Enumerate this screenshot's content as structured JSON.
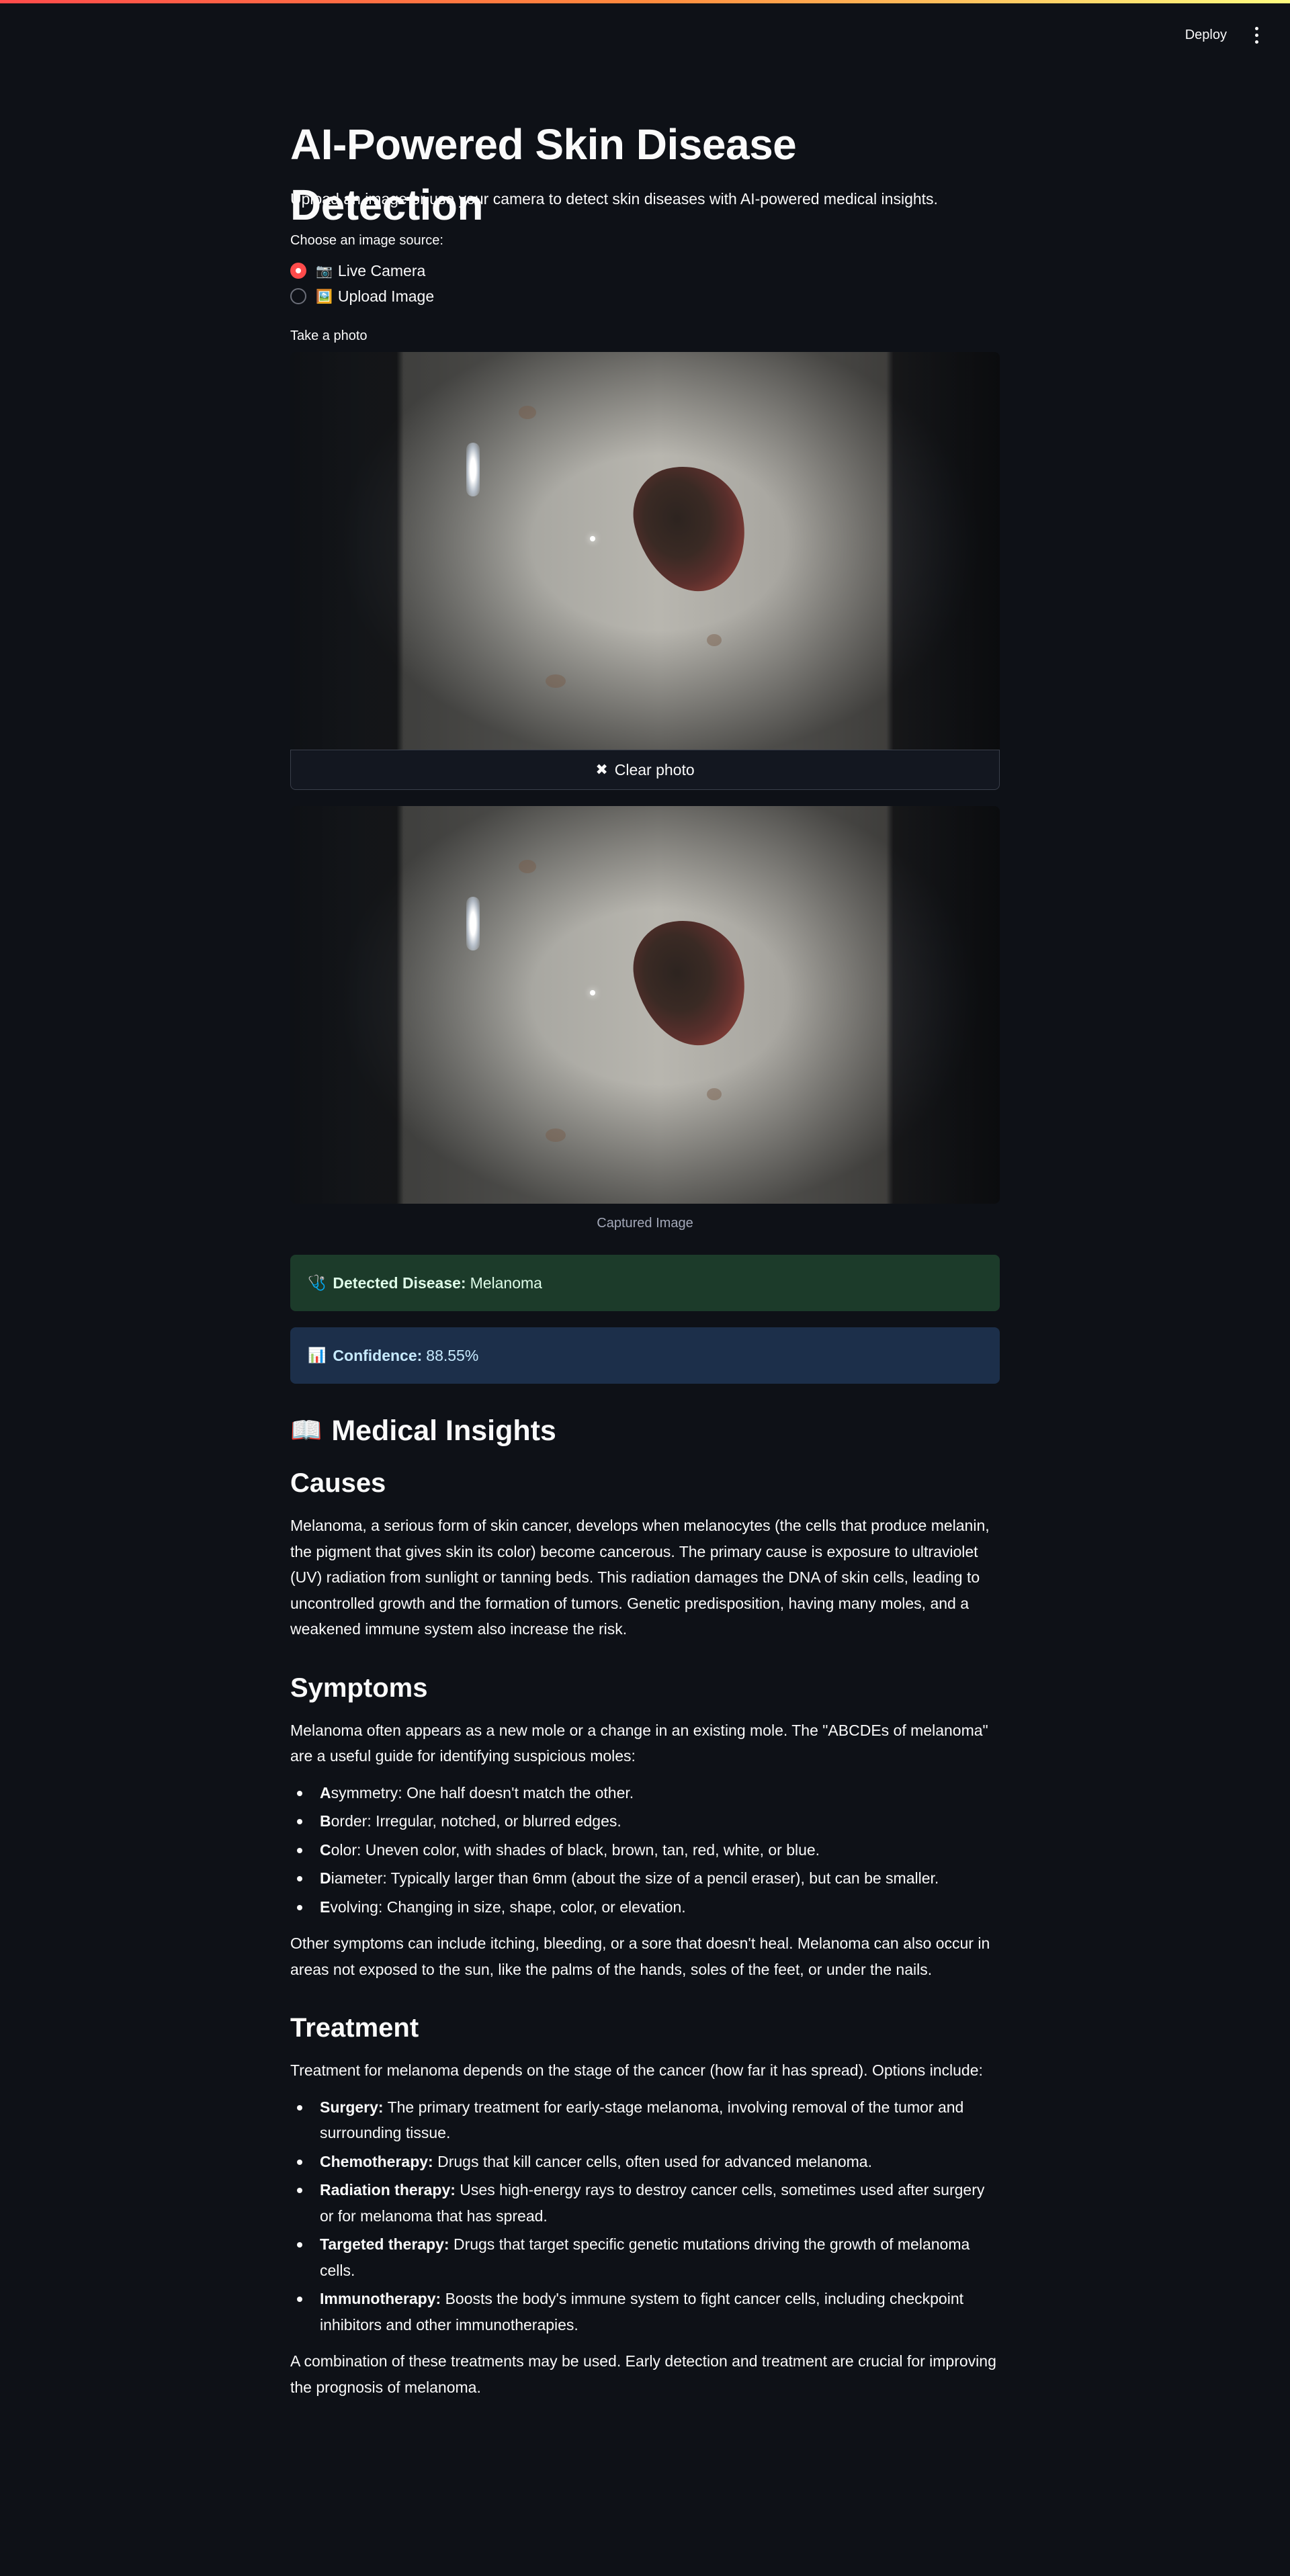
{
  "header": {
    "deploy_label": "Deploy"
  },
  "title": "AI-Powered Skin Disease Detection",
  "subtitle": "Upload an image or use your camera to detect skin diseases with AI-powered medical insights.",
  "source_radio": {
    "label": "Choose an image source:",
    "options": [
      {
        "emoji": "📷",
        "label": "Live Camera",
        "selected": true
      },
      {
        "emoji": "🖼️",
        "label": "Upload Image",
        "selected": false
      }
    ]
  },
  "camera": {
    "label": "Take a photo",
    "clear_label": "Clear photo"
  },
  "captured_caption": "Captured Image",
  "result": {
    "disease_emoji": "🩺",
    "disease_label": "Detected Disease:",
    "disease_value": "Melanoma",
    "confidence_emoji": "📊",
    "confidence_label": "Confidence:",
    "confidence_value": "88.55%"
  },
  "insights_heading": {
    "emoji": "📖",
    "text": "Medical Insights"
  },
  "causes": {
    "heading": "Causes",
    "text": "Melanoma, a serious form of skin cancer, develops when melanocytes (the cells that produce melanin, the pigment that gives skin its color) become cancerous. The primary cause is exposure to ultraviolet (UV) radiation from sunlight or tanning beds. This radiation damages the DNA of skin cells, leading to uncontrolled growth and the formation of tumors. Genetic predisposition, having many moles, and a weakened immune system also increase the risk."
  },
  "symptoms": {
    "heading": "Symptoms",
    "intro": "Melanoma often appears as a new mole or a change in an existing mole. The \"ABCDEs of melanoma\" are a useful guide for identifying suspicious moles:",
    "items": [
      {
        "letter": "A",
        "rest": "symmetry: One half doesn't match the other."
      },
      {
        "letter": "B",
        "rest": "order: Irregular, notched, or blurred edges."
      },
      {
        "letter": "C",
        "rest": "olor: Uneven color, with shades of black, brown, tan, red, white, or blue."
      },
      {
        "letter": "D",
        "rest": "iameter: Typically larger than 6mm (about the size of a pencil eraser), but can be smaller."
      },
      {
        "letter": "E",
        "rest": "volving: Changing in size, shape, color, or elevation."
      }
    ],
    "outro": "Other symptoms can include itching, bleeding, or a sore that doesn't heal. Melanoma can also occur in areas not exposed to the sun, like the palms of the hands, soles of the feet, or under the nails."
  },
  "treatment": {
    "heading": "Treatment",
    "intro": "Treatment for melanoma depends on the stage of the cancer (how far it has spread). Options include:",
    "items": [
      {
        "term": "Surgery:",
        "text": " The primary treatment for early-stage melanoma, involving removal of the tumor and surrounding tissue."
      },
      {
        "term": "Chemotherapy:",
        "text": " Drugs that kill cancer cells, often used for advanced melanoma."
      },
      {
        "term": "Radiation therapy:",
        "text": " Uses high-energy rays to destroy cancer cells, sometimes used after surgery or for melanoma that has spread."
      },
      {
        "term": "Targeted therapy:",
        "text": " Drugs that target specific genetic mutations driving the growth of melanoma cells."
      },
      {
        "term": "Immunotherapy:",
        "text": " Boosts the body's immune system to fight cancer cells, including checkpoint inhibitors and other immunotherapies."
      }
    ],
    "outro": "A combination of these treatments may be used. Early detection and treatment are crucial for improving the prognosis of melanoma."
  },
  "colors": {
    "background": "#0e1117",
    "accent": "#ff4b4b",
    "success_bg": "#1c3b2a",
    "info_bg": "#1c2f4a"
  }
}
